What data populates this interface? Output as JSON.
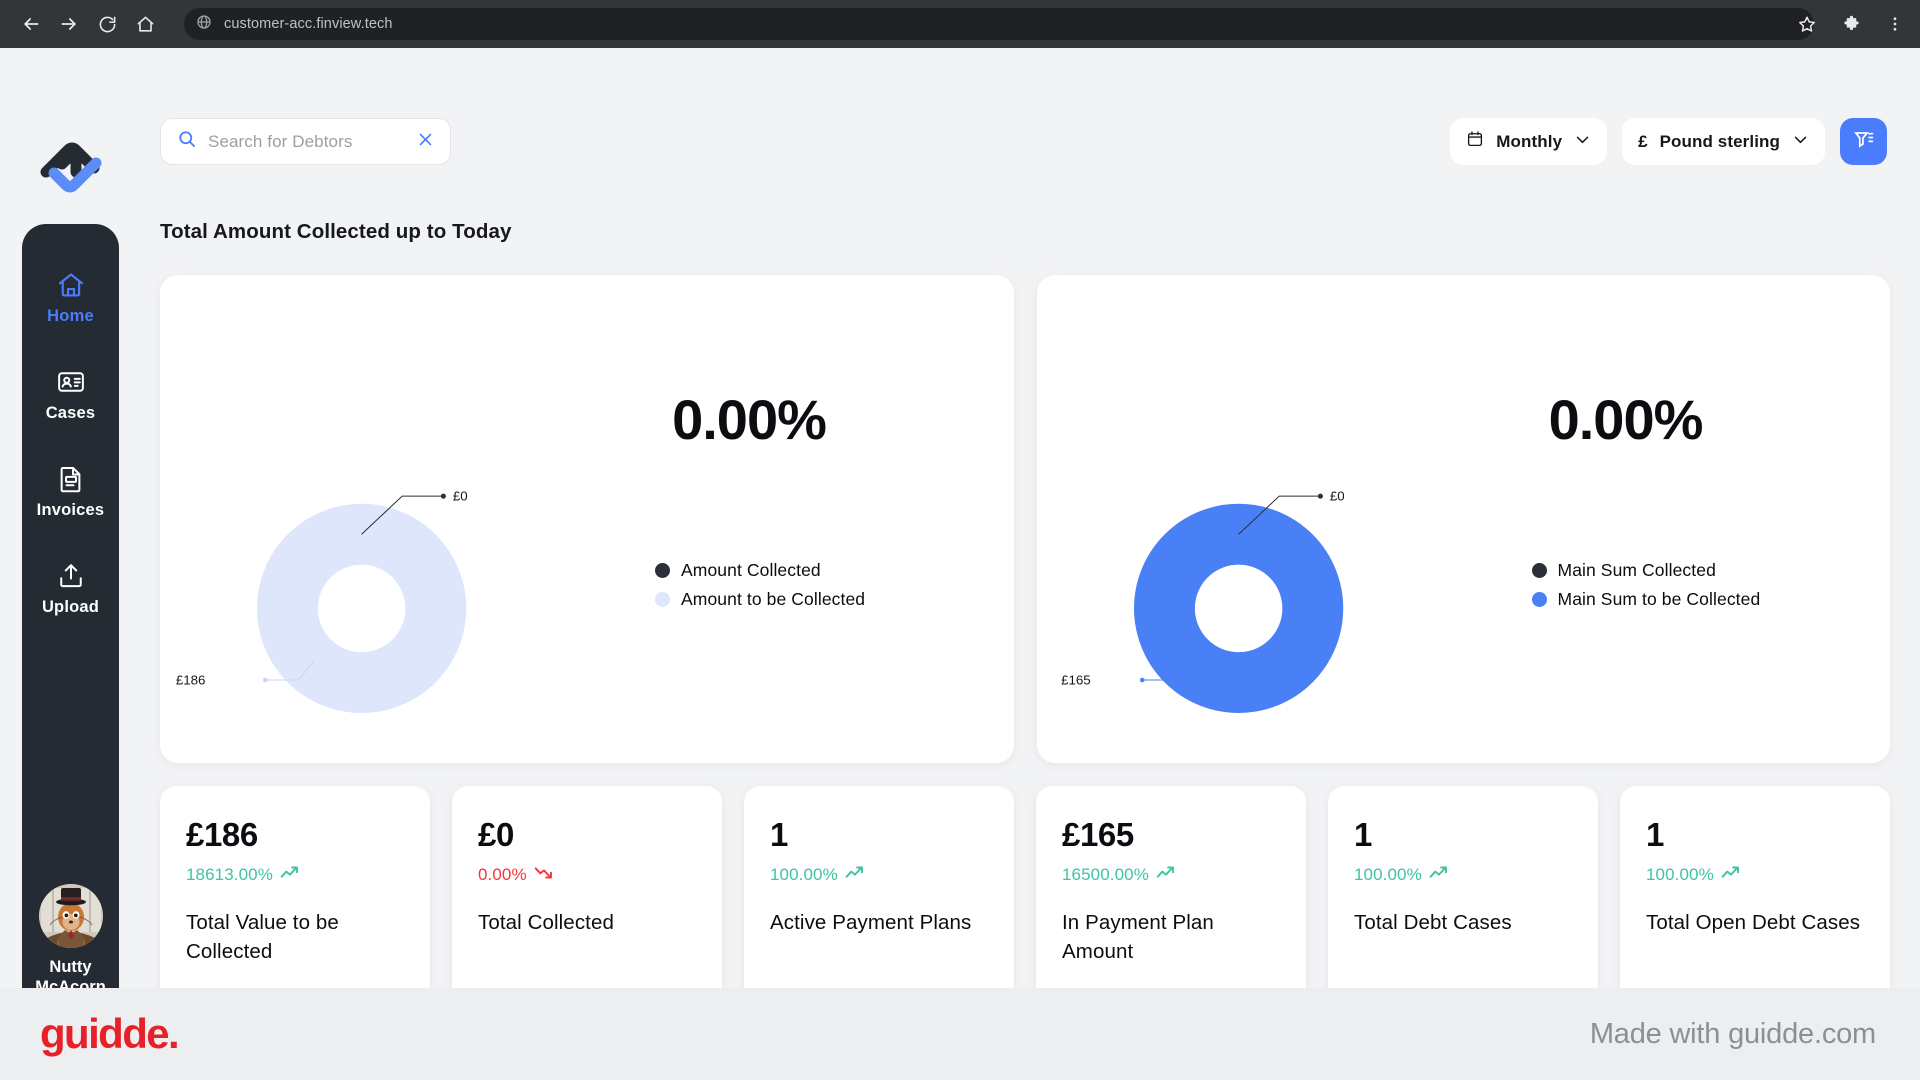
{
  "browser": {
    "url": "customer-acc.finview.tech",
    "back_icon": "back-arrow-icon",
    "forward_icon": "forward-arrow-icon",
    "reload_icon": "reload-icon",
    "home_icon": "home-icon",
    "site_icon": "globe-icon",
    "bookmark_icon": "star-icon",
    "extensions_icon": "puzzle-icon",
    "menu_icon": "three-dot-menu-icon"
  },
  "sidebar": {
    "logo_name": "finview-logo",
    "items": [
      {
        "label": "Home",
        "icon": "home-icon",
        "active": true
      },
      {
        "label": "Cases",
        "icon": "id-card-icon",
        "active": false
      },
      {
        "label": "Invoices",
        "icon": "document-icon",
        "active": false
      },
      {
        "label": "Upload",
        "icon": "upload-icon",
        "active": false
      }
    ],
    "user": {
      "name": "Nutty McAcorn",
      "avatar": "squirrel-top-hat-avatar"
    }
  },
  "search": {
    "placeholder": "Search for Debtors",
    "value": "",
    "icon": "search-icon",
    "clear_icon": "close-icon"
  },
  "toolbar": {
    "period_label": "Monthly",
    "period_icon": "calendar-icon",
    "period_chevron": "chevron-down-icon",
    "currency_symbol": "£",
    "currency_label": "Pound sterling",
    "currency_chevron": "chevron-down-icon",
    "filter_icon": "filter-icon",
    "filter_color": "#4a7dfc"
  },
  "main": {
    "page_title": "Total Amount Collected up to Today"
  },
  "chart_data": [
    {
      "type": "pie",
      "title": "Amount Collected",
      "center_value": "0.00%",
      "labels": [
        "Amount Collected",
        "Amount to be Collected"
      ],
      "values": [
        0,
        186
      ],
      "value_labels": [
        "£0",
        "£186"
      ],
      "colors": [
        "#2b3038",
        "#dee6fb"
      ],
      "legend": "right",
      "donut_hole": 0.47
    },
    {
      "type": "pie",
      "title": "Main Sum Collected",
      "center_value": "0.00%",
      "labels": [
        "Main Sum Collected",
        "Main Sum to be Collected"
      ],
      "values": [
        0,
        165
      ],
      "value_labels": [
        "£0",
        "£165"
      ],
      "colors": [
        "#2b3038",
        "#4a80f5"
      ],
      "legend": "right",
      "donut_hole": 0.47
    }
  ],
  "kpis": [
    {
      "value": "£186",
      "delta": "18613.00%",
      "direction": "up",
      "label": "Total Value to be Collected"
    },
    {
      "value": "£0",
      "delta": "0.00%",
      "direction": "down",
      "label": "Total Collected"
    },
    {
      "value": "1",
      "delta": "100.00%",
      "direction": "up",
      "label": "Active Payment Plans"
    },
    {
      "value": "£165",
      "delta": "16500.00%",
      "direction": "up",
      "label": "In Payment Plan Amount"
    },
    {
      "value": "1",
      "delta": "100.00%",
      "direction": "up",
      "label": "Total Debt Cases"
    },
    {
      "value": "1",
      "delta": "100.00%",
      "direction": "up",
      "label": "Total Open Debt Cases"
    }
  ],
  "footer": {
    "logo_text": "guidde.",
    "made_with": "Made with guidde.com"
  },
  "colors": {
    "accent": "#4a7dfc",
    "positive": "#3ec3a4",
    "negative": "#f8333c",
    "sidebar": "#252b33",
    "brand_red": "#e8202a"
  }
}
